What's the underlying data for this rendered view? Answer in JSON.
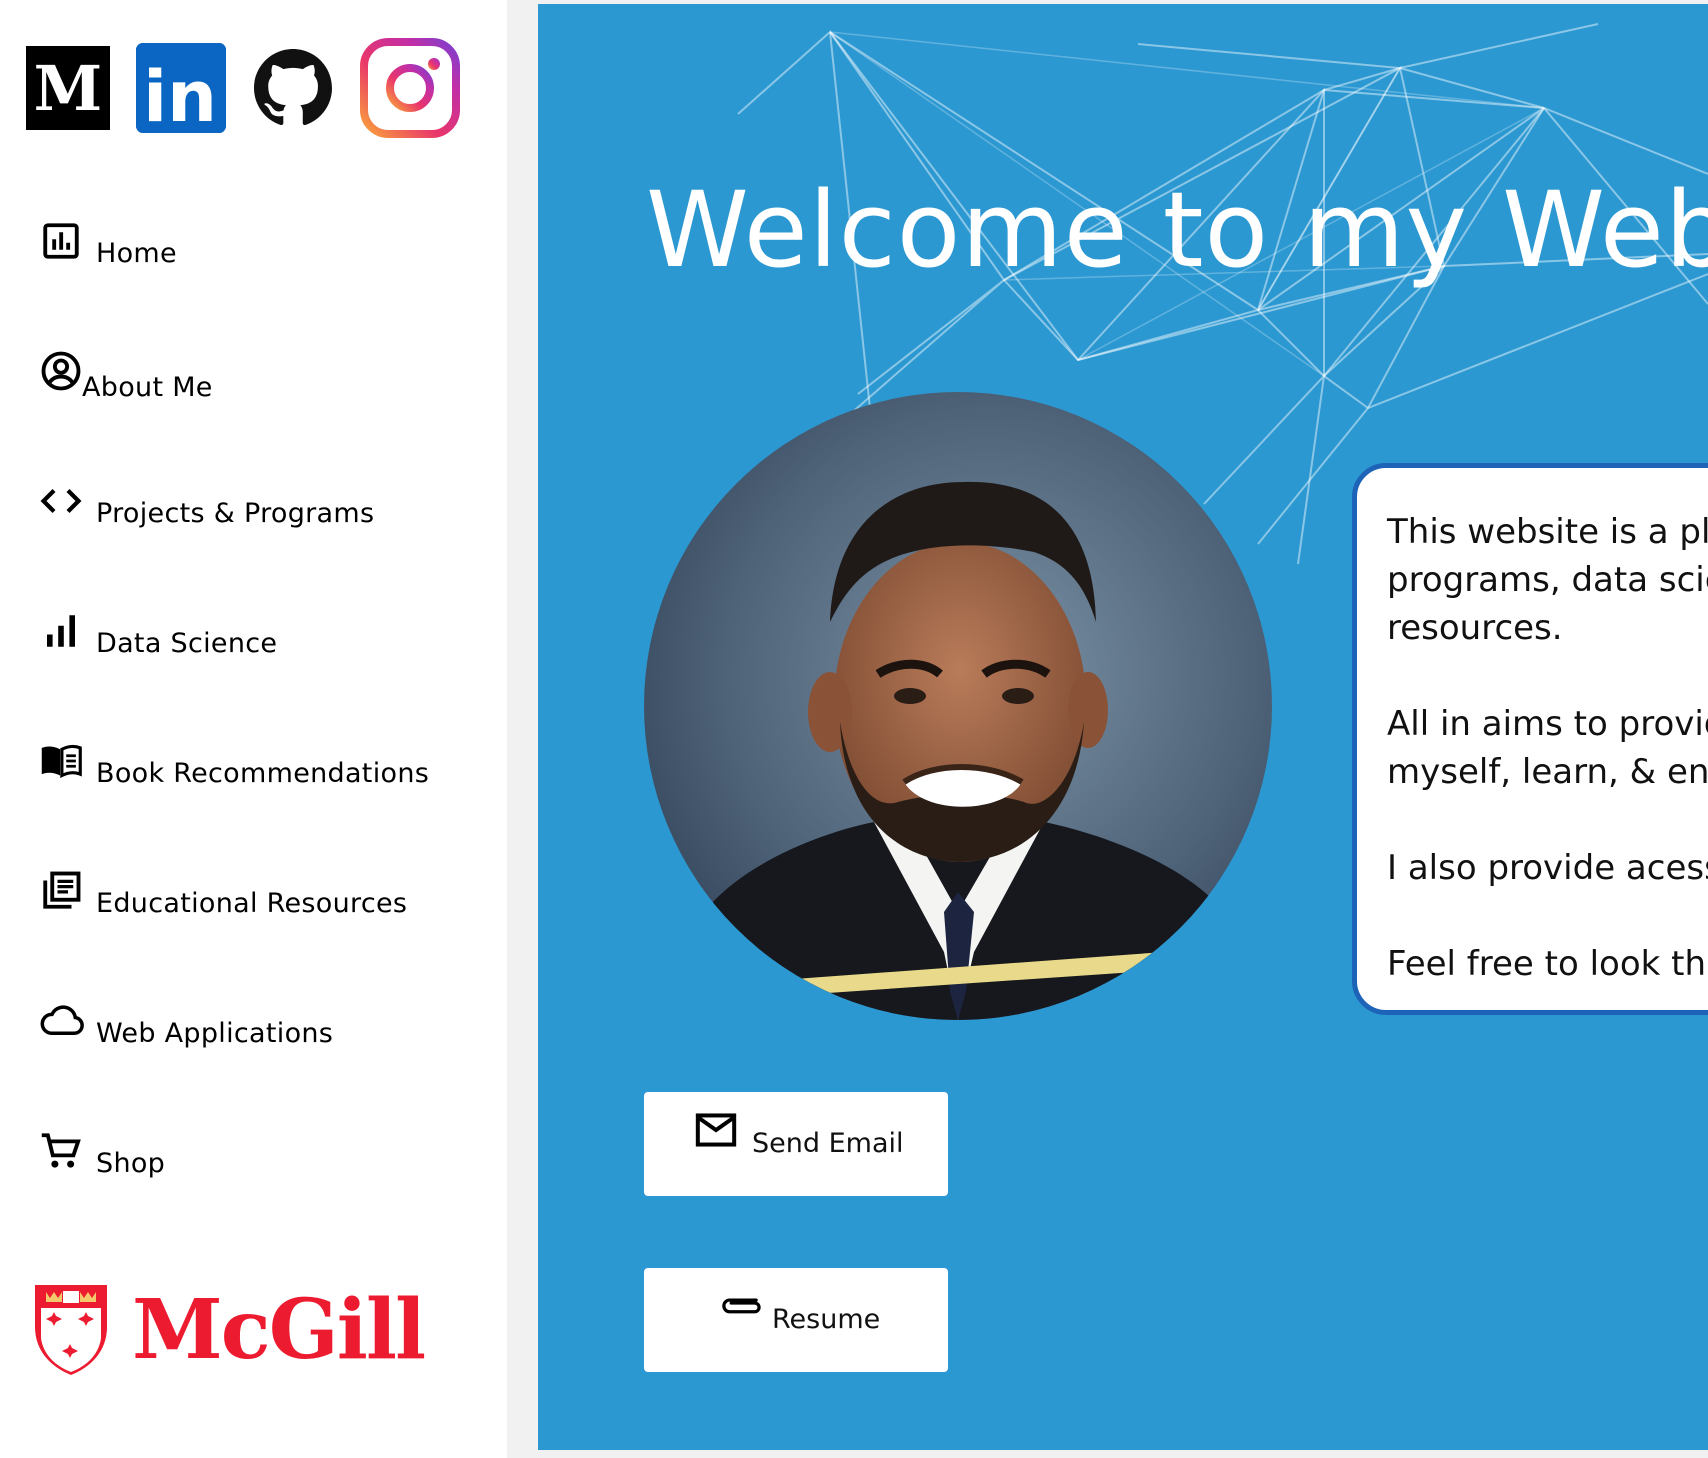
{
  "social": {
    "medium_letter": "M",
    "linkedin_text": "in",
    "icons": [
      "medium-icon",
      "linkedin-icon",
      "github-icon",
      "instagram-icon"
    ]
  },
  "nav": {
    "items": [
      {
        "label": "Home",
        "icon": "bar-chart-box-icon"
      },
      {
        "label": "About Me",
        "icon": "user-circle-icon"
      },
      {
        "label": "Projects & Programs",
        "icon": "code-brackets-icon"
      },
      {
        "label": "Data Science",
        "icon": "signal-bars-icon"
      },
      {
        "label": "Book Recommendations",
        "icon": "open-book-icon"
      },
      {
        "label": "Educational Resources",
        "icon": "documents-icon"
      },
      {
        "label": "Web Applications",
        "icon": "cloud-icon"
      },
      {
        "label": "Shop",
        "icon": "cart-icon"
      }
    ]
  },
  "logo": {
    "text": "McGill"
  },
  "hero": {
    "title": "Welcome to my Websit"
  },
  "intro": {
    "lines": [
      [
        "This website is a pla",
        "programs, data scie",
        "resources."
      ],
      [
        "All in aims to provid",
        "myself, learn, & eng"
      ],
      [
        "I also provide acess"
      ],
      [
        "Feel free to look thr"
      ]
    ]
  },
  "buttons": {
    "email": "Send Email",
    "resume": "Resume"
  },
  "colors": {
    "main_bg": "#2b98d2",
    "card_border": "#1d63b8",
    "mcgill_red": "#ed1b2f",
    "linkedin_blue": "#0a66c2"
  }
}
